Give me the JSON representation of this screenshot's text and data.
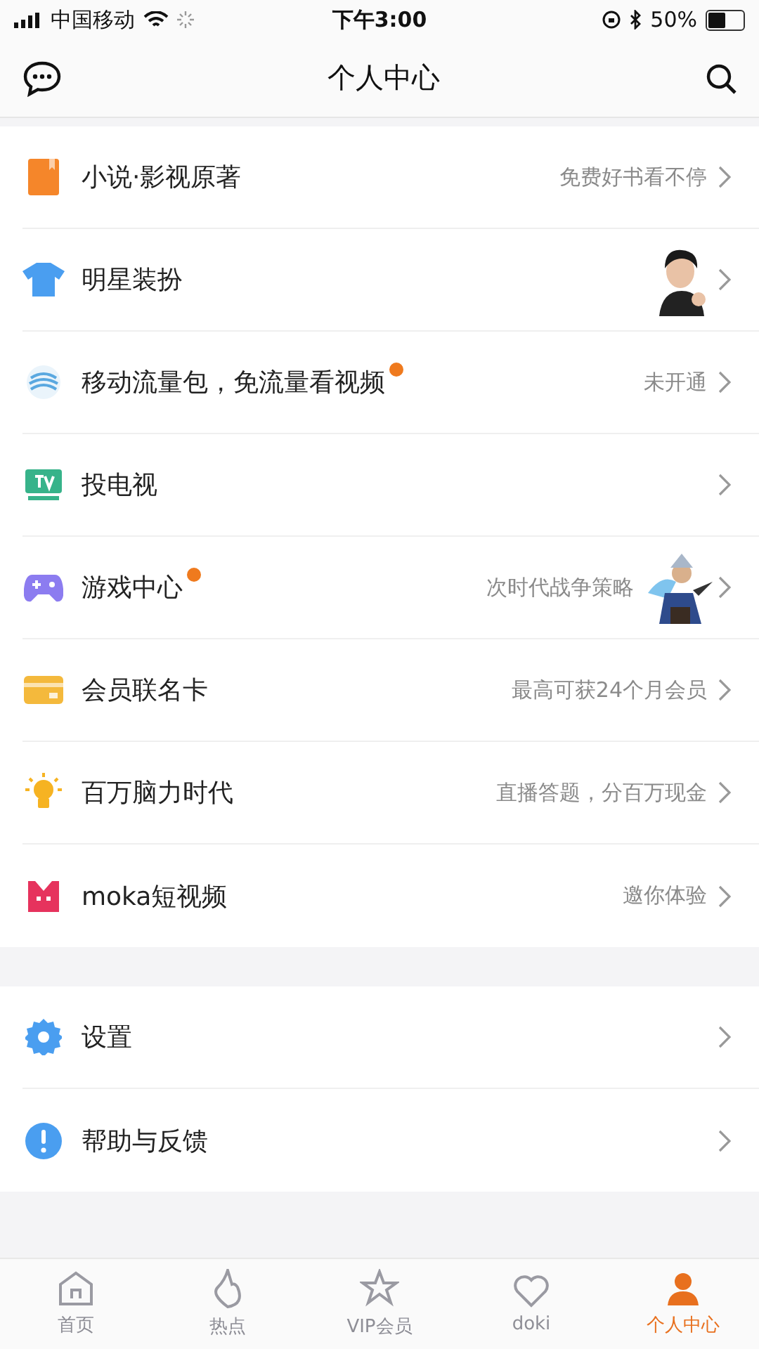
{
  "status_bar": {
    "carrier": "中国移动",
    "time": "下午3:00",
    "battery": "50%"
  },
  "header": {
    "title": "个人中心"
  },
  "sections": [
    {
      "items": [
        {
          "label": "小说·影视原著",
          "badge": false,
          "detail": "免费好书看不停",
          "picture": false
        },
        {
          "label": "明星装扮",
          "badge": false,
          "picture": true
        },
        {
          "label": "移动流量包，免流量看视频",
          "badge": true,
          "detail": "未开通",
          "picture": false
        },
        {
          "label": "投电视",
          "badge": false,
          "picture": false
        },
        {
          "label": "游戏中心",
          "badge": true,
          "detail": "次时代战争策略",
          "picture": true
        },
        {
          "label": "会员联名卡",
          "badge": false,
          "detail": "最高可获24个月会员",
          "picture": false
        },
        {
          "label": "百万脑力时代",
          "badge": false,
          "detail": "直播答题，分百万现金",
          "picture": false
        },
        {
          "label": "moka短视频",
          "badge": false,
          "detail": "邀你体验",
          "picture": false
        }
      ]
    },
    {
      "items": [
        {
          "label": "设置",
          "badge": false,
          "picture": false
        },
        {
          "label": "帮助与反馈",
          "badge": false,
          "picture": false
        }
      ]
    }
  ],
  "tabs": [
    {
      "label": "首页",
      "selected": false
    },
    {
      "label": "热点",
      "selected": false
    },
    {
      "label": "VIP会员",
      "selected": false
    },
    {
      "label": "doki",
      "selected": false
    },
    {
      "label": "个人中心",
      "selected": true
    }
  ]
}
